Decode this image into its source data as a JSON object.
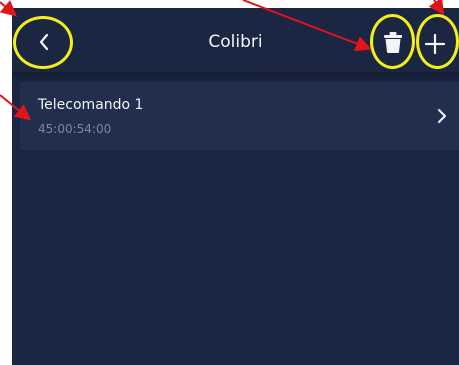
{
  "header": {
    "title": "Colibri",
    "back_icon": "chevron-left-icon",
    "delete_icon": "trash-icon",
    "add_icon": "plus-icon"
  },
  "list": {
    "items": [
      {
        "name": "Telecomando 1",
        "code": "45:00:54:00",
        "icon": "chevron-right-icon"
      }
    ]
  },
  "colors": {
    "background": "#1b2642",
    "list_item": "#222e4d",
    "highlight": "#f3ef1a",
    "arrow": "#e1141c"
  }
}
